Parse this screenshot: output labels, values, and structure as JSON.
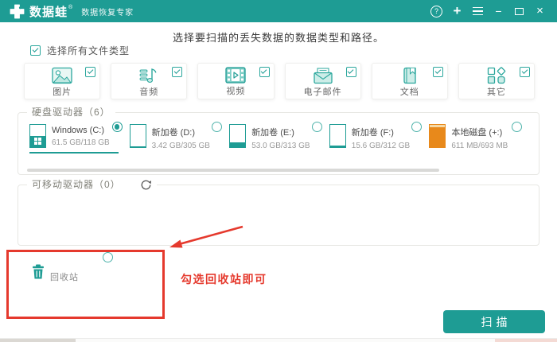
{
  "window": {
    "brand": "数据蛙",
    "brand_mark": "®",
    "tagline": "数据恢复专家",
    "controls": {
      "help": "?",
      "add": "+",
      "minimize": "−",
      "close": "×"
    }
  },
  "colors": {
    "accent": "#1E9C94",
    "orange": "#E8891B",
    "annotation_red": "#E5392D"
  },
  "main": {
    "title": "选择要扫描的丢失数据的数据类型和路径。",
    "select_all": {
      "label": "选择所有文件类型",
      "checked": true
    },
    "file_types": [
      {
        "label": "图片",
        "icon": "image-icon",
        "checked": true
      },
      {
        "label": "音频",
        "icon": "audio-icon",
        "checked": true
      },
      {
        "label": "视频",
        "icon": "video-icon",
        "checked": true
      },
      {
        "label": "电子邮件",
        "icon": "email-icon",
        "checked": true
      },
      {
        "label": "文档",
        "icon": "document-icon",
        "checked": true
      },
      {
        "label": "其它",
        "icon": "other-icon",
        "checked": true
      }
    ],
    "hard_drives": {
      "title": "硬盘驱动器（6）",
      "drives": [
        {
          "name": "Windows (C:)",
          "capacity": "61.5 GB/118 GB",
          "used_percent": 50,
          "color": "#1E9C94",
          "bg": "#ffffff",
          "selected": true
        },
        {
          "name": "新加卷 (D:)",
          "capacity": "3.42 GB/305 GB",
          "used_percent": 3,
          "color": "#1E9C94",
          "bg": "#ffffff",
          "selected": false
        },
        {
          "name": "新加卷 (E:)",
          "capacity": "53.0 GB/313 GB",
          "used_percent": 20,
          "color": "#1E9C94",
          "bg": "#ffffff",
          "selected": false
        },
        {
          "name": "新加卷 (F:)",
          "capacity": "15.6 GB/312 GB",
          "used_percent": 7,
          "color": "#1E9C94",
          "bg": "#ffffff",
          "selected": false
        },
        {
          "name": "本地磁盘 (+:)",
          "capacity": "611 MB/693 MB",
          "used_percent": 88,
          "color": "#E8891B",
          "bg": "#F5D9A6",
          "selected": false
        }
      ]
    },
    "removable_drives": {
      "title": "可移动驱动器（0）"
    },
    "recycle_bin": {
      "label": "回收站",
      "checked": false
    },
    "annotation": {
      "text": "勾选回收站即可"
    },
    "scan_button_label": "扫描"
  }
}
